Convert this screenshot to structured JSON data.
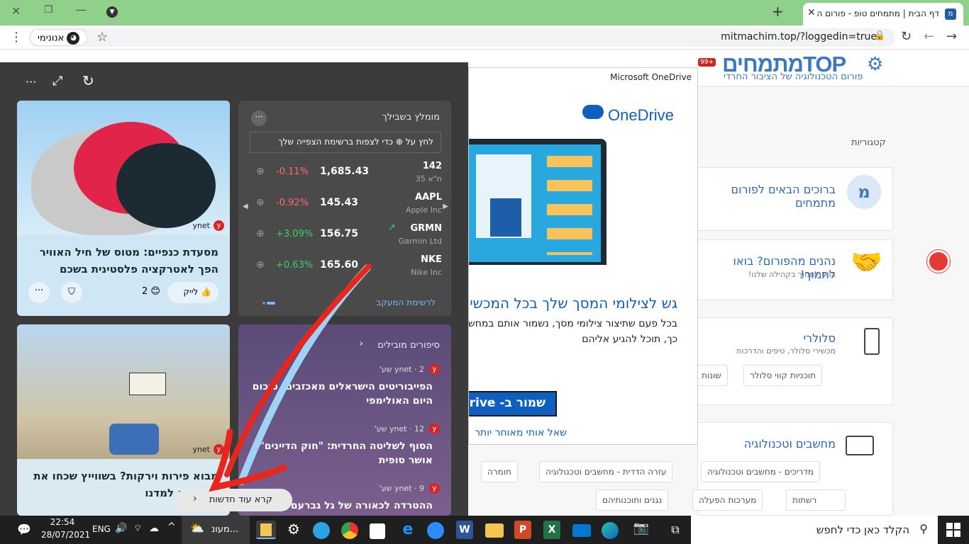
{
  "browser": {
    "tab_title": "דף הבית | מתמחים טופ - פורום ה",
    "new_tab": "+",
    "url": "mitmachim.top/?loggedin=true",
    "incognito_label": "אנונימי"
  },
  "site": {
    "logo": "מתמחיםTOP",
    "tagline": "פורום הטכנולוגיה של הציבור החרדי",
    "notif_count": "99+",
    "categories_label": "קטגוריות",
    "cards": [
      {
        "title": "ברוכים הבאים לפורום מתמחים",
        "sub": ""
      },
      {
        "title": "נהנים מהפורום? בואו לתמוך!",
        "sub": "בואו לתמוך בקהילה שלנו!"
      },
      {
        "title": "סלולרי",
        "sub": "מכשירי סלולר, טיפים והדרכות",
        "chips": [
          "תוכניות קווי סלולר",
          "שונות"
        ]
      },
      {
        "title": "מחשבים וטכנולוגיה",
        "sub": "",
        "chips": [
          "מדריכים - מחשבים וטכנולוגיה",
          "עזרה הדדית - מחשבים וטכנולוגיה",
          "חומרה",
          "רשתות",
          "מערכות הפעלה",
          "נגנים ותוכנותיהם"
        ]
      }
    ]
  },
  "onedrive": {
    "header": "Microsoft OneDrive",
    "brand": "OneDrive",
    "heading": "גש לצילומי המסך שלך בכל המכשירים",
    "body": "בכל פעם שתיצור צילומי מסך, נשמור אותם במחשב באופן מקוון ב- OneDrive. כך, תוכל להגיע אליהם",
    "save_button": "שמור ב- OneDrive",
    "later_link": "שאל אותי מאוחר יותר"
  },
  "widgets": {
    "recommended_title": "מומלץ בשבילך",
    "watchlist_hint": "לחץ על ⊕ כדי לצפות ברשימת הצפייה שלך",
    "stocks": [
      {
        "symbol": "142",
        "name": "ת\"א 35",
        "price": "1,685.43",
        "change": "-0.11%",
        "dir": "down"
      },
      {
        "symbol": "AAPL",
        "name": "Apple Inc",
        "price": "145.43",
        "change": "-0.92%",
        "dir": "down"
      },
      {
        "symbol": "GRMN",
        "name": "Garmin Ltd",
        "price": "156.75",
        "change": "+3.09%",
        "dir": "up"
      },
      {
        "symbol": "NKE",
        "name": "Nike Inc",
        "price": "165.60",
        "change": "+0.63%",
        "dir": "up"
      }
    ],
    "watchlist_link": "לרשימת המעקב",
    "top_stories_title": "סיפורים מובילים",
    "stories": [
      {
        "source": "ynet · 2 שע'",
        "title": "הפייבוריטים הישראלים מאכזבים: סיכום היום האולימפי"
      },
      {
        "source": "ynet · 12 שע'",
        "title": "הסוף לשליטה החרדית: \"חוק הדיינים\" אושר סופית"
      },
      {
        "source": "ynet · 9 שע'",
        "title": "ההטרדה לכאורה של גל גברעם הדוג"
      }
    ],
    "news1": {
      "source": "ynet",
      "title": "מסעדת כנפיים: מטוס של חיל האוויר הפך לאטרקציה פלסטינית בשכם",
      "like": "לייק",
      "reactions": "2"
    },
    "news2": {
      "source": "ynet",
      "title": "מבוא פירות וירקות? בשווייץ שכחו את מה שלא למדנו"
    },
    "more_news": "קרא עוד חדשות"
  },
  "taskbar": {
    "search_placeholder": "הקלד כאן כדי לחפש",
    "weather": "מעונ...",
    "lang": "ENG",
    "time": "22:54",
    "date": "28/07/2021"
  },
  "colors": {
    "tab_bar": "#8fd08a",
    "panel": "#3b3b3b",
    "stock_down": "#ff6b6b",
    "stock_up": "#3ccf6e",
    "onedrive_blue": "#0f5fbf",
    "site_blue": "#3a78c4"
  }
}
